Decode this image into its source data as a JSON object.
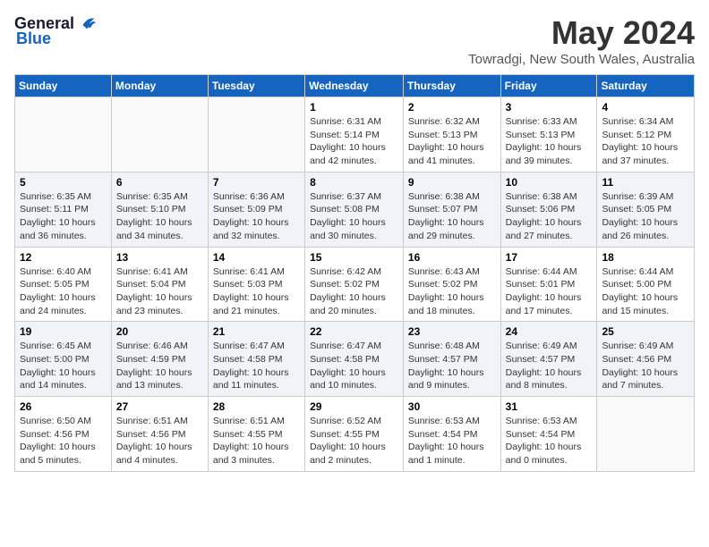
{
  "logo": {
    "general": "General",
    "blue": "Blue"
  },
  "title": {
    "month_year": "May 2024",
    "location": "Towradgi, New South Wales, Australia"
  },
  "days_of_week": [
    "Sunday",
    "Monday",
    "Tuesday",
    "Wednesday",
    "Thursday",
    "Friday",
    "Saturday"
  ],
  "weeks": [
    [
      {
        "day": "",
        "sunrise": "",
        "sunset": "",
        "daylight": ""
      },
      {
        "day": "",
        "sunrise": "",
        "sunset": "",
        "daylight": ""
      },
      {
        "day": "",
        "sunrise": "",
        "sunset": "",
        "daylight": ""
      },
      {
        "day": "1",
        "sunrise": "Sunrise: 6:31 AM",
        "sunset": "Sunset: 5:14 PM",
        "daylight": "Daylight: 10 hours and 42 minutes."
      },
      {
        "day": "2",
        "sunrise": "Sunrise: 6:32 AM",
        "sunset": "Sunset: 5:13 PM",
        "daylight": "Daylight: 10 hours and 41 minutes."
      },
      {
        "day": "3",
        "sunrise": "Sunrise: 6:33 AM",
        "sunset": "Sunset: 5:13 PM",
        "daylight": "Daylight: 10 hours and 39 minutes."
      },
      {
        "day": "4",
        "sunrise": "Sunrise: 6:34 AM",
        "sunset": "Sunset: 5:12 PM",
        "daylight": "Daylight: 10 hours and 37 minutes."
      }
    ],
    [
      {
        "day": "5",
        "sunrise": "Sunrise: 6:35 AM",
        "sunset": "Sunset: 5:11 PM",
        "daylight": "Daylight: 10 hours and 36 minutes."
      },
      {
        "day": "6",
        "sunrise": "Sunrise: 6:35 AM",
        "sunset": "Sunset: 5:10 PM",
        "daylight": "Daylight: 10 hours and 34 minutes."
      },
      {
        "day": "7",
        "sunrise": "Sunrise: 6:36 AM",
        "sunset": "Sunset: 5:09 PM",
        "daylight": "Daylight: 10 hours and 32 minutes."
      },
      {
        "day": "8",
        "sunrise": "Sunrise: 6:37 AM",
        "sunset": "Sunset: 5:08 PM",
        "daylight": "Daylight: 10 hours and 30 minutes."
      },
      {
        "day": "9",
        "sunrise": "Sunrise: 6:38 AM",
        "sunset": "Sunset: 5:07 PM",
        "daylight": "Daylight: 10 hours and 29 minutes."
      },
      {
        "day": "10",
        "sunrise": "Sunrise: 6:38 AM",
        "sunset": "Sunset: 5:06 PM",
        "daylight": "Daylight: 10 hours and 27 minutes."
      },
      {
        "day": "11",
        "sunrise": "Sunrise: 6:39 AM",
        "sunset": "Sunset: 5:05 PM",
        "daylight": "Daylight: 10 hours and 26 minutes."
      }
    ],
    [
      {
        "day": "12",
        "sunrise": "Sunrise: 6:40 AM",
        "sunset": "Sunset: 5:05 PM",
        "daylight": "Daylight: 10 hours and 24 minutes."
      },
      {
        "day": "13",
        "sunrise": "Sunrise: 6:41 AM",
        "sunset": "Sunset: 5:04 PM",
        "daylight": "Daylight: 10 hours and 23 minutes."
      },
      {
        "day": "14",
        "sunrise": "Sunrise: 6:41 AM",
        "sunset": "Sunset: 5:03 PM",
        "daylight": "Daylight: 10 hours and 21 minutes."
      },
      {
        "day": "15",
        "sunrise": "Sunrise: 6:42 AM",
        "sunset": "Sunset: 5:02 PM",
        "daylight": "Daylight: 10 hours and 20 minutes."
      },
      {
        "day": "16",
        "sunrise": "Sunrise: 6:43 AM",
        "sunset": "Sunset: 5:02 PM",
        "daylight": "Daylight: 10 hours and 18 minutes."
      },
      {
        "day": "17",
        "sunrise": "Sunrise: 6:44 AM",
        "sunset": "Sunset: 5:01 PM",
        "daylight": "Daylight: 10 hours and 17 minutes."
      },
      {
        "day": "18",
        "sunrise": "Sunrise: 6:44 AM",
        "sunset": "Sunset: 5:00 PM",
        "daylight": "Daylight: 10 hours and 15 minutes."
      }
    ],
    [
      {
        "day": "19",
        "sunrise": "Sunrise: 6:45 AM",
        "sunset": "Sunset: 5:00 PM",
        "daylight": "Daylight: 10 hours and 14 minutes."
      },
      {
        "day": "20",
        "sunrise": "Sunrise: 6:46 AM",
        "sunset": "Sunset: 4:59 PM",
        "daylight": "Daylight: 10 hours and 13 minutes."
      },
      {
        "day": "21",
        "sunrise": "Sunrise: 6:47 AM",
        "sunset": "Sunset: 4:58 PM",
        "daylight": "Daylight: 10 hours and 11 minutes."
      },
      {
        "day": "22",
        "sunrise": "Sunrise: 6:47 AM",
        "sunset": "Sunset: 4:58 PM",
        "daylight": "Daylight: 10 hours and 10 minutes."
      },
      {
        "day": "23",
        "sunrise": "Sunrise: 6:48 AM",
        "sunset": "Sunset: 4:57 PM",
        "daylight": "Daylight: 10 hours and 9 minutes."
      },
      {
        "day": "24",
        "sunrise": "Sunrise: 6:49 AM",
        "sunset": "Sunset: 4:57 PM",
        "daylight": "Daylight: 10 hours and 8 minutes."
      },
      {
        "day": "25",
        "sunrise": "Sunrise: 6:49 AM",
        "sunset": "Sunset: 4:56 PM",
        "daylight": "Daylight: 10 hours and 7 minutes."
      }
    ],
    [
      {
        "day": "26",
        "sunrise": "Sunrise: 6:50 AM",
        "sunset": "Sunset: 4:56 PM",
        "daylight": "Daylight: 10 hours and 5 minutes."
      },
      {
        "day": "27",
        "sunrise": "Sunrise: 6:51 AM",
        "sunset": "Sunset: 4:56 PM",
        "daylight": "Daylight: 10 hours and 4 minutes."
      },
      {
        "day": "28",
        "sunrise": "Sunrise: 6:51 AM",
        "sunset": "Sunset: 4:55 PM",
        "daylight": "Daylight: 10 hours and 3 minutes."
      },
      {
        "day": "29",
        "sunrise": "Sunrise: 6:52 AM",
        "sunset": "Sunset: 4:55 PM",
        "daylight": "Daylight: 10 hours and 2 minutes."
      },
      {
        "day": "30",
        "sunrise": "Sunrise: 6:53 AM",
        "sunset": "Sunset: 4:54 PM",
        "daylight": "Daylight: 10 hours and 1 minute."
      },
      {
        "day": "31",
        "sunrise": "Sunrise: 6:53 AM",
        "sunset": "Sunset: 4:54 PM",
        "daylight": "Daylight: 10 hours and 0 minutes."
      },
      {
        "day": "",
        "sunrise": "",
        "sunset": "",
        "daylight": ""
      }
    ]
  ]
}
